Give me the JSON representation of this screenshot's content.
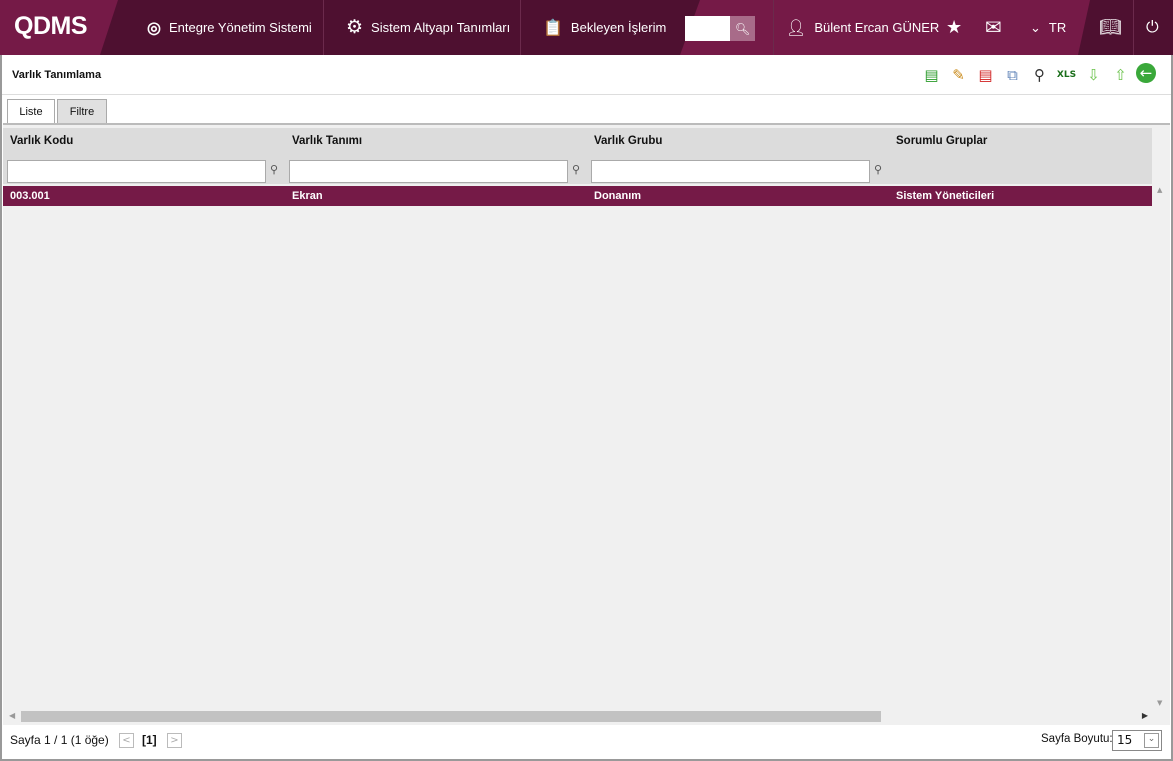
{
  "header": {
    "logo": "QDMS",
    "nav": [
      {
        "label": "Entegre Yönetim Sistemi",
        "icon": "q-logo-icon"
      },
      {
        "label": "Sistem Altyapı Tanımları",
        "icon": "gear-icon"
      },
      {
        "label": "Bekleyen İşlerim",
        "icon": "clipboard-icon"
      }
    ],
    "search_value": "",
    "user": "Bülent Ercan GÜNER",
    "language": "TR"
  },
  "page": {
    "title": "Varlık Tanımlama",
    "tabs": [
      "Liste",
      "Filtre"
    ],
    "toolbar": [
      "add",
      "edit",
      "delete",
      "copy",
      "find",
      "export-xls",
      "move-down",
      "move-up",
      "back"
    ]
  },
  "grid": {
    "columns": [
      "Varlık Kodu",
      "Varlık Tanımı",
      "Varlık Grubu",
      "Sorumlu Gruplar"
    ],
    "rows": [
      [
        "003.001",
        "Ekran",
        "Donanım",
        "Sistem Yöneticileri"
      ]
    ]
  },
  "footer": {
    "page_info": "Sayfa 1 / 1 (1 öğe)",
    "current_page": "[1]",
    "page_size_label": "Sayfa Boyutu:",
    "page_size": "15"
  },
  "colors": {
    "brand": "#751a47",
    "brand_dark": "#4e1030"
  }
}
